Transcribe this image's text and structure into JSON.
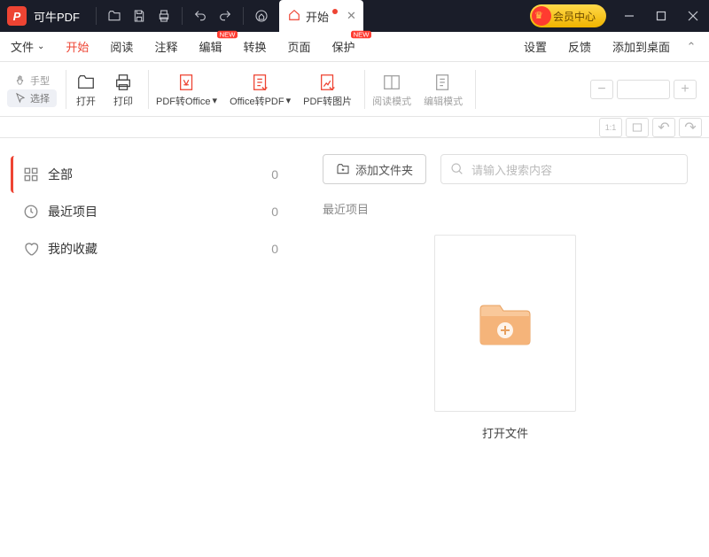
{
  "app": {
    "title": "可牛PDF"
  },
  "tab": {
    "label": "开始"
  },
  "vip": {
    "label": "会员中心"
  },
  "menu": {
    "file": "文件",
    "start": "开始",
    "read": "阅读",
    "annotate": "注释",
    "edit": "编辑",
    "convert": "转换",
    "page": "页面",
    "protect": "保护",
    "settings": "设置",
    "feedback": "反馈",
    "addDesktop": "添加到桌面",
    "newBadge": "NEW"
  },
  "ribbon": {
    "hand": "手型",
    "select": "选择",
    "open": "打开",
    "print": "打印",
    "pdfToOffice": "PDF转Office",
    "officeToPdf": "Office转PDF",
    "pdfToImage": "PDF转图片",
    "readMode": "阅读模式",
    "editMode": "编辑模式"
  },
  "sidebar": {
    "items": [
      {
        "label": "全部",
        "count": 0
      },
      {
        "label": "最近项目",
        "count": 0
      },
      {
        "label": "我的收藏",
        "count": 0
      }
    ]
  },
  "content": {
    "addFolder": "添加文件夹",
    "searchPlaceholder": "请输入搜索内容",
    "recentTitle": "最近项目",
    "openFile": "打开文件"
  }
}
